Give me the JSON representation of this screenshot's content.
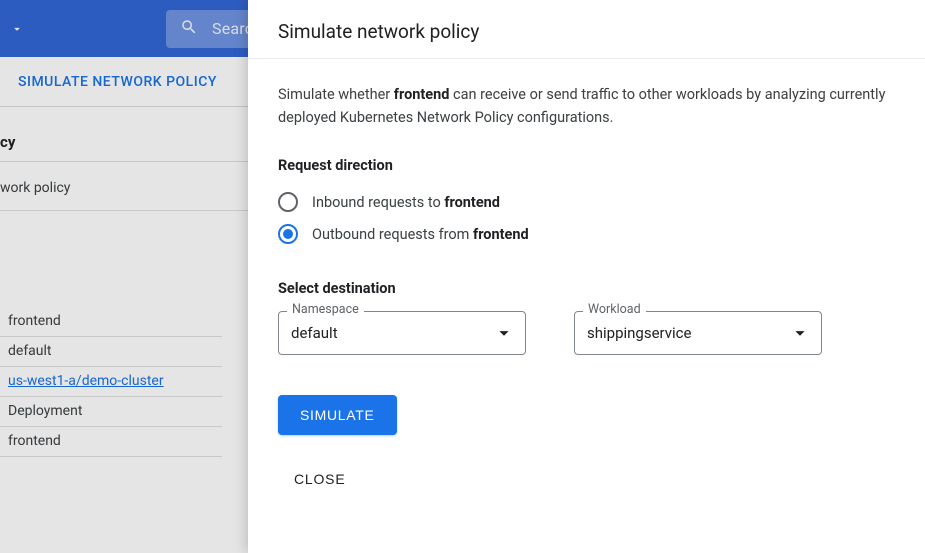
{
  "topbar": {
    "search_placeholder": "Search"
  },
  "tab": {
    "label": "SIMULATE NETWORK POLICY"
  },
  "bg": {
    "heading_frag": "cy",
    "sub_frag": "work policy",
    "rows": [
      "frontend",
      "default",
      "us-west1-a/demo-cluster",
      "Deployment",
      "frontend"
    ]
  },
  "panel": {
    "title": "Simulate network policy",
    "desc_prefix": "Simulate whether ",
    "desc_workload": "frontend",
    "desc_suffix": " can receive or send traffic to other workloads by analyzing currently deployed Kubernetes Network Policy configurations.",
    "direction": {
      "title": "Request direction",
      "inbound_prefix": "Inbound requests to ",
      "inbound_target": "frontend",
      "outbound_prefix": "Outbound requests from ",
      "outbound_target": "frontend",
      "selected": "outbound"
    },
    "destination": {
      "title": "Select destination",
      "namespace_label": "Namespace",
      "namespace_value": "default",
      "workload_label": "Workload",
      "workload_value": "shippingservice"
    },
    "simulate_label": "SIMULATE",
    "close_label": "CLOSE"
  }
}
